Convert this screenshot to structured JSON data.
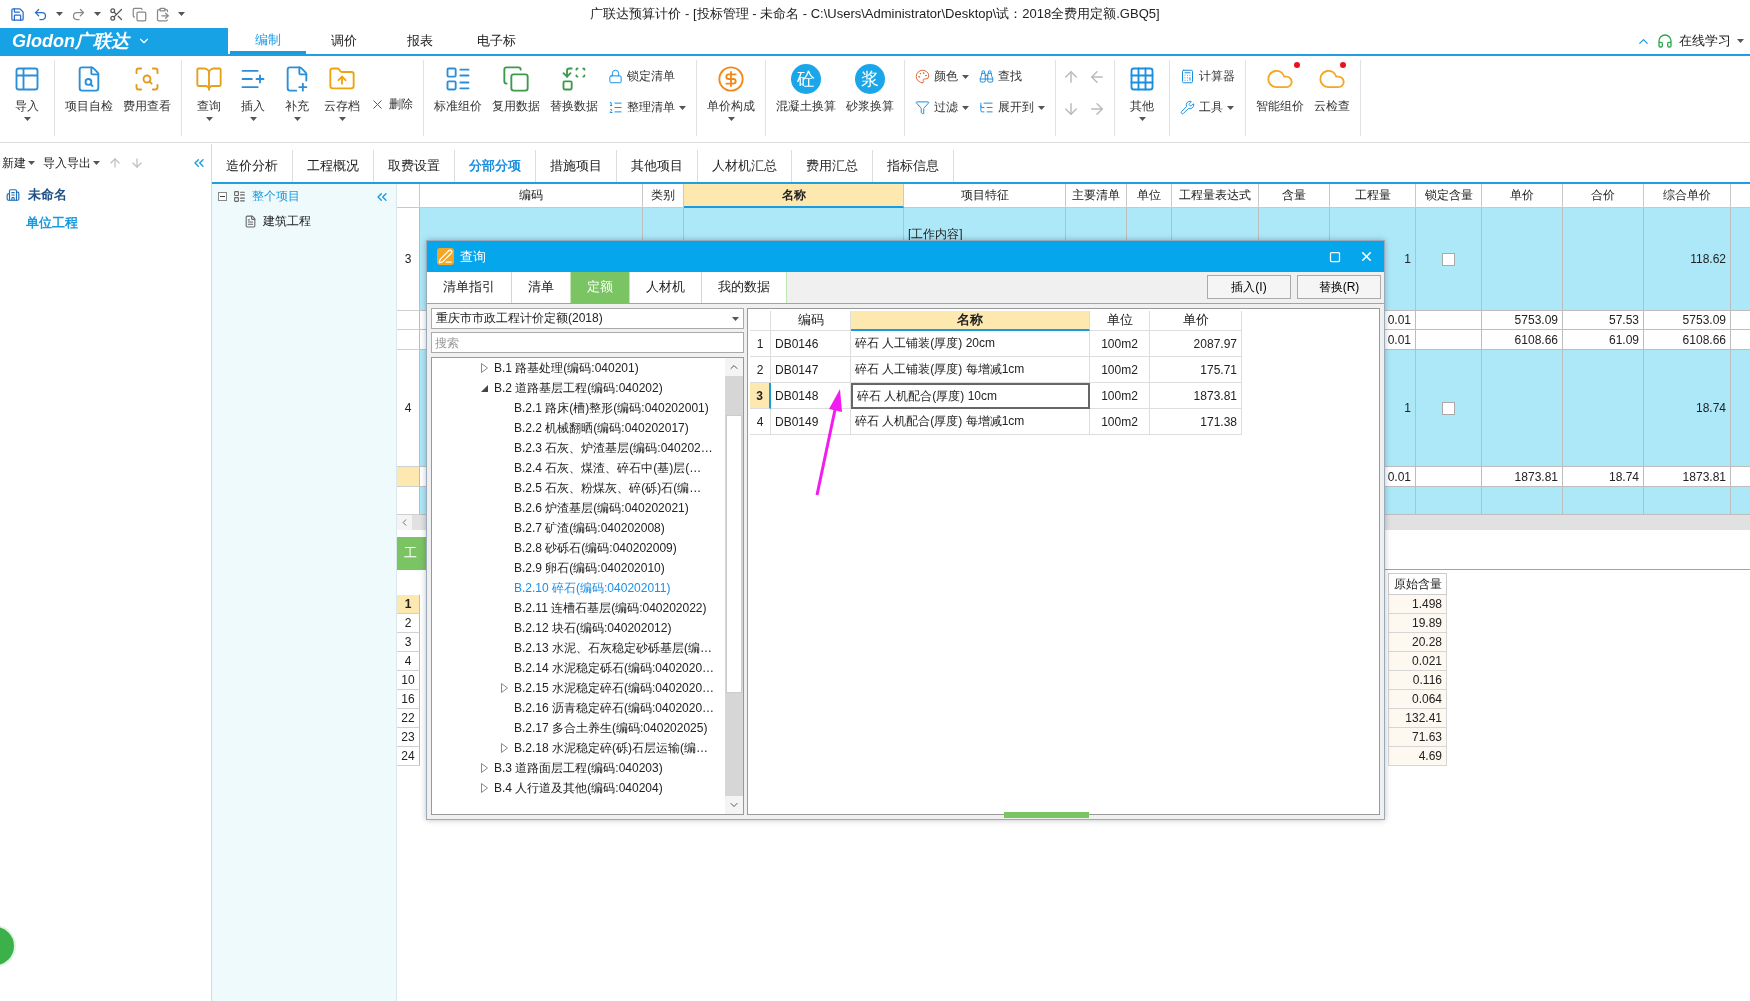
{
  "title_bar": {
    "title": "广联达预算计价 - [投标管理 - 未命名 - C:\\Users\\Administrator\\Desktop\\试：2018全费用定额.GBQ5]"
  },
  "menu_bar": {
    "logo": "Glodon广联达",
    "tabs": [
      {
        "label": "编制",
        "selected": true
      },
      {
        "label": "调价",
        "selected": false
      },
      {
        "label": "报表",
        "selected": false
      },
      {
        "label": "电子标",
        "selected": false
      }
    ],
    "help": "在线学习"
  },
  "ribbon": {
    "groups": [
      {
        "items": [
          {
            "kind": "large",
            "label": "导入",
            "dropdown": true
          }
        ]
      },
      {
        "items": [
          {
            "kind": "large",
            "label": "项目自检",
            "dropdown": false
          },
          {
            "kind": "large",
            "label": "费用查看",
            "dropdown": false
          }
        ]
      },
      {
        "items": [
          {
            "kind": "large",
            "label": "查询",
            "dropdown": true
          },
          {
            "kind": "large",
            "label": "插入",
            "dropdown": true
          },
          {
            "kind": "large",
            "label": "补充",
            "dropdown": true
          },
          {
            "kind": "large",
            "label": "云存档",
            "dropdown": true
          },
          {
            "kind": "small",
            "label": "删除",
            "dropdown": false
          }
        ]
      },
      {
        "items": [
          {
            "kind": "large",
            "label": "标准组价",
            "dropdown": false
          },
          {
            "kind": "large",
            "label": "复用数据",
            "dropdown": false
          },
          {
            "kind": "large",
            "label": "替换数据",
            "dropdown": false
          },
          {
            "kind": "stack",
            "items": [
              {
                "label": "锁定清单",
                "dropdown": false
              },
              {
                "label": "整理清单",
                "dropdown": true
              }
            ]
          }
        ]
      },
      {
        "items": [
          {
            "kind": "large",
            "label": "单价构成",
            "dropdown": true
          }
        ]
      },
      {
        "items": [
          {
            "kind": "glyph",
            "label": "混凝土换算",
            "glyph": "砼"
          },
          {
            "kind": "glyph",
            "label": "砂浆换算",
            "glyph": "浆"
          }
        ]
      },
      {
        "items": [
          {
            "kind": "stack",
            "items": [
              {
                "label": "颜色",
                "dropdown": true
              },
              {
                "label": "过滤",
                "dropdown": true
              }
            ]
          },
          {
            "kind": "stack",
            "items": [
              {
                "label": "查找",
                "dropdown": false
              },
              {
                "label": "展开到",
                "dropdown": true
              }
            ]
          }
        ]
      },
      {
        "items": [
          {
            "kind": "arrows"
          }
        ]
      },
      {
        "items": [
          {
            "kind": "large",
            "label": "其他",
            "dropdown": true
          }
        ]
      },
      {
        "items": [
          {
            "kind": "stack",
            "items": [
              {
                "label": "计算器",
                "dropdown": false
              },
              {
                "label": "工具",
                "dropdown": true
              }
            ]
          }
        ]
      },
      {
        "items": [
          {
            "kind": "alert",
            "label": "智能组价"
          },
          {
            "kind": "alert",
            "label": "云检查"
          }
        ]
      }
    ]
  },
  "left_pane": {
    "toolbar": [
      {
        "label": "新建",
        "dropdown": true
      },
      {
        "label": "导入导出",
        "dropdown": true
      }
    ],
    "tree": [
      {
        "label": "未命名",
        "children": [
          {
            "label": "单位工程"
          }
        ]
      }
    ]
  },
  "view_tabs": [
    {
      "label": "造价分析",
      "selected": false
    },
    {
      "label": "工程概况",
      "selected": false
    },
    {
      "label": "取费设置",
      "selected": false
    },
    {
      "label": "分部分项",
      "selected": true
    },
    {
      "label": "措施项目",
      "selected": false
    },
    {
      "label": "其他项目",
      "selected": false
    },
    {
      "label": "人材机汇总",
      "selected": false
    },
    {
      "label": "费用汇总",
      "selected": false
    },
    {
      "label": "指标信息",
      "selected": false
    }
  ],
  "project_tree": [
    {
      "label": "整个项目",
      "selected": true,
      "expanded": true,
      "children": [
        {
          "label": "建筑工程",
          "selected": false
        }
      ]
    }
  ],
  "main_grid": {
    "columns": [
      {
        "label": "编码",
        "selected": false
      },
      {
        "label": "类别",
        "selected": false
      },
      {
        "label": "名称",
        "selected": true
      },
      {
        "label": "项目特征",
        "selected": false
      },
      {
        "label": "主要清单",
        "selected": false
      },
      {
        "label": "单位",
        "selected": false
      },
      {
        "label": "工程量表达式",
        "selected": false
      },
      {
        "label": "含量",
        "selected": false
      },
      {
        "label": "工程量",
        "selected": false
      },
      {
        "label": "锁定含量",
        "selected": false
      },
      {
        "label": "单价",
        "selected": false
      },
      {
        "label": "合价",
        "selected": false
      },
      {
        "label": "综合单价",
        "selected": false
      }
    ],
    "rows": [
      {
        "kind": "item",
        "selected": false,
        "num": "3",
        "feature": "[工作内容]",
        "qty": "1",
        "locked": false,
        "unit_total": "118.62"
      },
      {
        "kind": "sub",
        "selected": false,
        "qty": "0.01",
        "price": "5753.09",
        "total": "57.53",
        "unit_total": "5753.09"
      },
      {
        "kind": "sub",
        "selected": false,
        "qty": "0.01",
        "price": "6108.66",
        "total": "61.09",
        "unit_total": "6108.66"
      },
      {
        "kind": "item",
        "selected": false,
        "num": "4",
        "qty": "1",
        "locked": false,
        "unit_total": "18.74"
      },
      {
        "kind": "sub",
        "selected": true,
        "qty": "0.01",
        "price": "1873.81",
        "total": "18.74",
        "unit_total": "1873.81"
      },
      {
        "kind": "blank",
        "selected": false
      }
    ]
  },
  "bottom_pane": {
    "tab": "工",
    "column": "原始含量",
    "rows": [
      {
        "num": "1",
        "selected": true,
        "value": "1.498"
      },
      {
        "num": "2",
        "selected": false,
        "value": "19.89"
      },
      {
        "num": "3",
        "selected": false,
        "value": "20.28"
      },
      {
        "num": "4",
        "selected": false,
        "value": "0.021"
      },
      {
        "num": "10",
        "selected": false,
        "value": "0.116"
      },
      {
        "num": "16",
        "selected": false,
        "value": "0.064"
      },
      {
        "num": "22",
        "selected": false,
        "value": "132.41"
      },
      {
        "num": "23",
        "selected": false,
        "value": "71.63"
      },
      {
        "num": "24",
        "selected": false,
        "value": "4.69"
      }
    ]
  },
  "dialog": {
    "title": "查询",
    "tabs": [
      {
        "label": "清单指引",
        "selected": false
      },
      {
        "label": "清单",
        "selected": false
      },
      {
        "label": "定额",
        "selected": true
      },
      {
        "label": "人材机",
        "selected": false
      },
      {
        "label": "我的数据",
        "selected": false
      }
    ],
    "buttons": [
      "插入(I)",
      "替换(R)"
    ],
    "library": "重庆市市政工程计价定额(2018)",
    "search": {
      "placeholder": "搜索"
    },
    "tree": [
      {
        "label": "B.1 路基处理(编码:040201)",
        "selected": false,
        "expanded": false
      },
      {
        "label": "B.2 道路基层工程(编码:040202)",
        "selected": false,
        "expanded": true,
        "children": [
          {
            "label": "B.2.1 路床(槽)整形(编码:040202001)",
            "selected": false
          },
          {
            "label": "B.2.2 机械翻晒(编码:040202017)",
            "selected": false
          },
          {
            "label": "B.2.3 石灰、炉渣基层(编码:040202…",
            "selected": false
          },
          {
            "label": "B.2.4 石灰、煤渣、碎石中(基)层(…",
            "selected": false
          },
          {
            "label": "B.2.5 石灰、粉煤灰、碎(砾)石(编…",
            "selected": false
          },
          {
            "label": "B.2.6 炉渣基层(编码:040202021)",
            "selected": false
          },
          {
            "label": "B.2.7 矿渣(编码:040202008)",
            "selected": false
          },
          {
            "label": "B.2.8 砂砾石(编码:040202009)",
            "selected": false
          },
          {
            "label": "B.2.9 卵石(编码:040202010)",
            "selected": false
          },
          {
            "label": "B.2.10 碎石(编码:040202011)",
            "selected": true
          },
          {
            "label": "B.2.11 连槽石基层(编码:040202022)",
            "selected": false
          },
          {
            "label": "B.2.12 块石(编码:040202012)",
            "selected": false
          },
          {
            "label": "B.2.13 水泥、石灰稳定砂砾基层(编…",
            "selected": false
          },
          {
            "label": "B.2.14 水泥稳定砾石(编码:0402020…",
            "selected": false
          },
          {
            "label": "B.2.15 水泥稳定碎石(编码:0402020…",
            "selected": false,
            "expanded": false
          },
          {
            "label": "B.2.16 沥青稳定碎石(编码:0402020…",
            "selected": false
          },
          {
            "label": "B.2.17 多合土养生(编码:040202025)",
            "selected": false
          },
          {
            "label": "B.2.18 水泥稳定碎(砾)石层运输(编…",
            "selected": false,
            "expanded": false
          }
        ]
      },
      {
        "label": "B.3 道路面层工程(编码:040203)",
        "selected": false,
        "expanded": false
      },
      {
        "label": "B.4 人行道及其他(编码:040204)",
        "selected": false,
        "expanded": false
      }
    ],
    "table": {
      "columns": [
        {
          "label": "编码",
          "selected": false
        },
        {
          "label": "名称",
          "selected": true
        },
        {
          "label": "单位",
          "selected": false
        },
        {
          "label": "单价",
          "selected": false
        }
      ],
      "rows": [
        {
          "num": "1",
          "code": "DB0146",
          "name": "碎石 人工铺装(厚度) 20cm",
          "unit": "100m2",
          "price": "2087.97",
          "selected": false
        },
        {
          "num": "2",
          "code": "DB0147",
          "name": "碎石 人工铺装(厚度) 每增减1cm",
          "unit": "100m2",
          "price": "175.71",
          "selected": false
        },
        {
          "num": "3",
          "code": "DB0148",
          "name": "碎石 人机配合(厚度) 10cm",
          "unit": "100m2",
          "price": "1873.81",
          "selected": true
        },
        {
          "num": "4",
          "code": "DB0149",
          "name": "碎石 人机配合(厚度) 每增减1cm",
          "unit": "100m2",
          "price": "171.38",
          "selected": false
        }
      ]
    }
  }
}
